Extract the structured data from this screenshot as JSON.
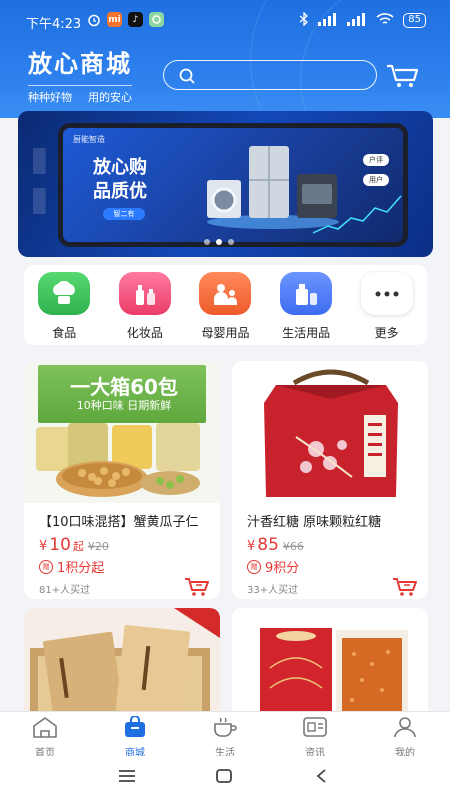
{
  "status_bar": {
    "time": "下午4:23",
    "app_icons": [
      "alarm-icon",
      "mi-icon",
      "tiktok-icon",
      "app-icon"
    ],
    "network": [
      "HD",
      "HD"
    ],
    "battery": "85"
  },
  "header": {
    "title": "放心商城",
    "slogan_left": "种种好物",
    "slogan_right": "用的安心",
    "search_placeholder": ""
  },
  "banner": {
    "maker_label": "厨能智造",
    "promo_line1": "放心购",
    "promo_line2": "品质优",
    "pill_text": "智二有",
    "tags": [
      "户评",
      "用户"
    ],
    "dots": 3,
    "active_dot": 1
  },
  "categories": [
    {
      "label": "食品",
      "icon": "food-icon",
      "color": "#3cc25b"
    },
    {
      "label": "化妆品",
      "icon": "cosmetics-icon",
      "color": "#f2557a"
    },
    {
      "label": "母婴用品",
      "icon": "baby-icon",
      "color": "#f26a3d"
    },
    {
      "label": "生活用品",
      "icon": "daily-goods-icon",
      "color": "#4b7bf5"
    },
    {
      "label": "更多",
      "icon": "more-icon",
      "color": "#ffffff"
    }
  ],
  "products": [
    {
      "img_title": "一大箱60包",
      "img_sub": "10种口味 日期新鲜",
      "name": "【10口味混搭】蟹黄瓜子仁",
      "currency": "¥",
      "price": "10",
      "qi": "起",
      "orig": "¥20",
      "points": "1积分起",
      "points_badge": "赠",
      "sold": "81+人买过"
    },
    {
      "name": "汁香红糖 原味颗粒红糖",
      "currency": "¥",
      "price": "85",
      "orig": "¥66",
      "points": "9积分",
      "points_badge": "赠",
      "sold": "33+人买过"
    }
  ],
  "bottom_nav": [
    {
      "label": "首页",
      "icon": "home-icon"
    },
    {
      "label": "商城",
      "icon": "mall-bag-icon",
      "active": true
    },
    {
      "label": "生活",
      "icon": "life-icon"
    },
    {
      "label": "资讯",
      "icon": "news-icon"
    },
    {
      "label": "我的",
      "icon": "profile-icon"
    }
  ],
  "colors": {
    "brand": "#1f6fe0",
    "price": "#e53935"
  }
}
